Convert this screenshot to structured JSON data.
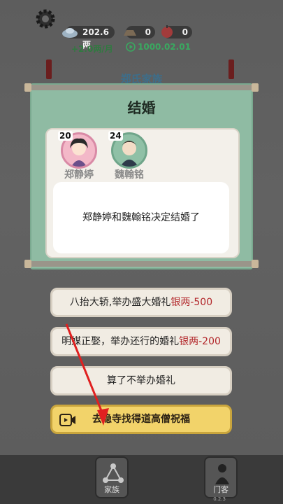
{
  "status": {
    "silver_value": "202.6两",
    "res_a_value": "0",
    "res_b_value": "0",
    "sub_left_text": "+2.0两/月",
    "date_text": "1000.02.01"
  },
  "background": {
    "family_title": "郑氏家族",
    "nav": {
      "home_label": "家族",
      "gate_label": "门客"
    },
    "version": "0.2.3"
  },
  "dialog": {
    "title": "结婚",
    "persons": [
      {
        "name": "郑静婷",
        "age": "20"
      },
      {
        "name": "魏翰铭",
        "age": "24"
      }
    ],
    "message": "郑静婷和魏翰铭决定结婚了"
  },
  "options": [
    {
      "label": "八抬大轿,举办盛大婚礼",
      "cost": "银两-500"
    },
    {
      "label": "明媒正娶，举办还行的婚礼",
      "cost": "银两-200"
    },
    {
      "label": "算了不举办婚礼",
      "cost": ""
    },
    {
      "label": "去隐寺找得道高僧祝福",
      "cost": ""
    }
  ],
  "colors": {
    "dialog_bg": "#8fbba3",
    "cost_red": "#b2262a",
    "highlight_button": "#f2d36a",
    "arrow_red": "#e02020"
  }
}
